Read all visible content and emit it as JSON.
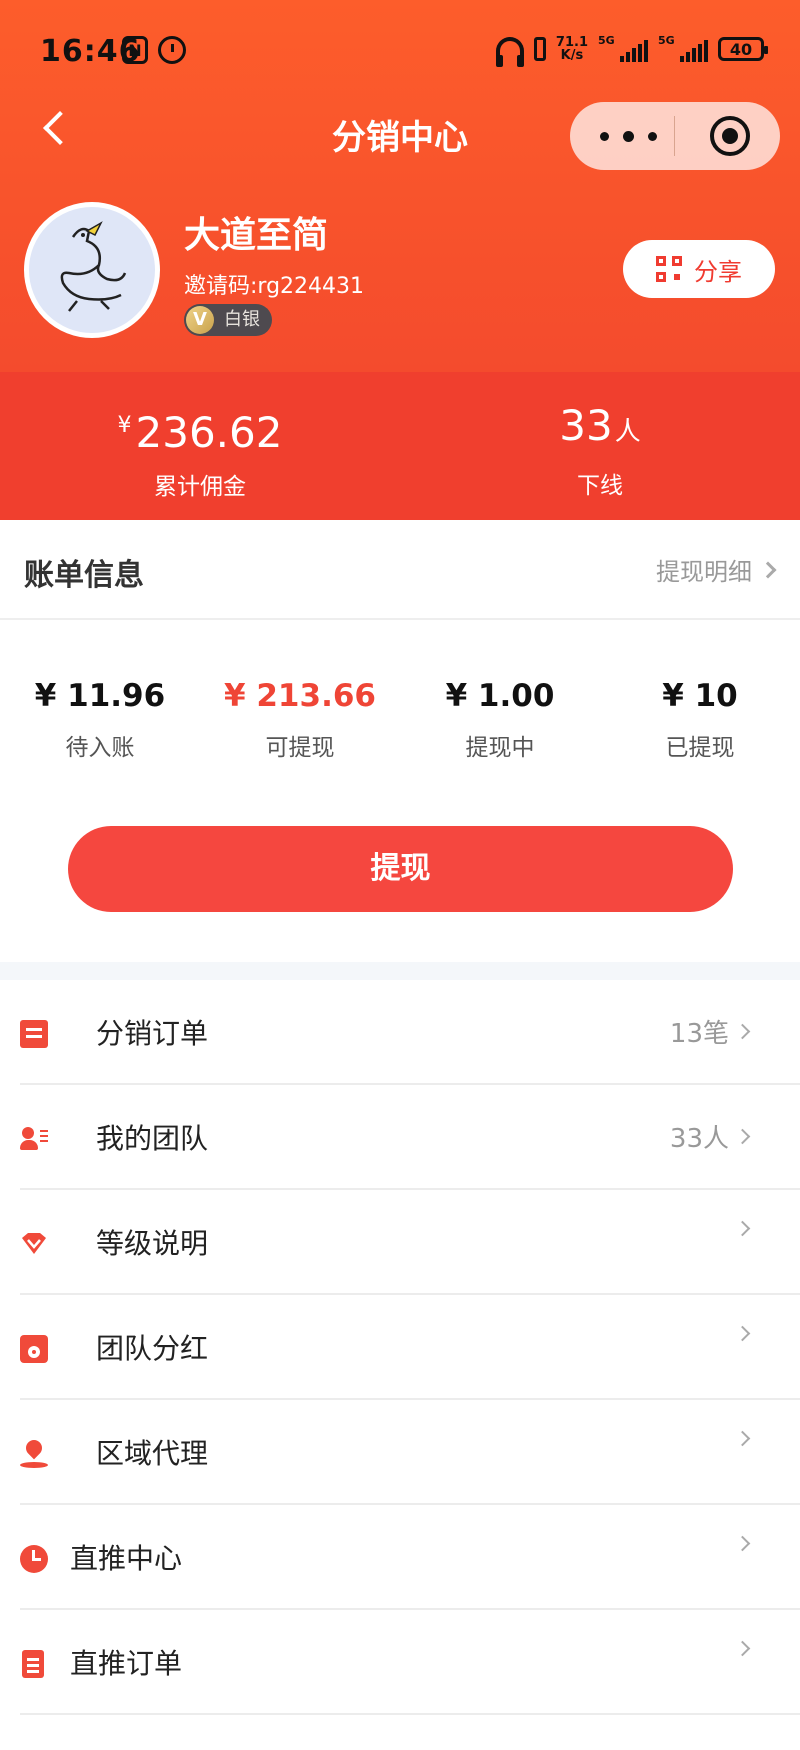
{
  "status_bar": {
    "time": "16:46",
    "network_speed_top": "71.1",
    "network_speed_bottom": "K/s",
    "sim1": "5G",
    "sim2": "5G",
    "battery": "40"
  },
  "nav": {
    "title": "分销中心"
  },
  "profile": {
    "name": "大道至简",
    "invite_code": "邀请码:rg224431",
    "level_badge": "V",
    "level": "白银",
    "share_label": "分享"
  },
  "stats": {
    "commission_currency": "¥",
    "commission_value": "236.62",
    "commission_label": "累计佣金",
    "downline_value": "33",
    "downline_unit": "人",
    "downline_label": "下线"
  },
  "bill": {
    "title": "账单信息",
    "detail_link": "提现明细",
    "amounts": [
      {
        "value": "¥ 11.96",
        "label": "待入账"
      },
      {
        "value": "¥ 213.66",
        "label": "可提现"
      },
      {
        "value": "¥ 1.00",
        "label": "提现中"
      },
      {
        "value": "¥ 10",
        "label": "已提现"
      }
    ],
    "withdraw_button": "提现"
  },
  "menu": [
    {
      "label": "分销订单",
      "value": "13笔",
      "icon": "document-icon"
    },
    {
      "label": "我的团队",
      "value": "33人",
      "icon": "team-icon"
    },
    {
      "label": "等级说明",
      "value": "",
      "icon": "diamond-icon"
    },
    {
      "label": "团队分红",
      "value": "",
      "icon": "bonus-icon"
    },
    {
      "label": "区域代理",
      "value": "",
      "icon": "location-icon"
    },
    {
      "label": "直推中心",
      "value": "",
      "icon": "clock-icon"
    },
    {
      "label": "直推订单",
      "value": "",
      "icon": "order-list-icon"
    }
  ],
  "colors": {
    "header_gradient_top": "#fd5d2b",
    "stats_band": "#f03f2e",
    "accent_red": "#f5473f",
    "available_amount": "#ef4536"
  }
}
